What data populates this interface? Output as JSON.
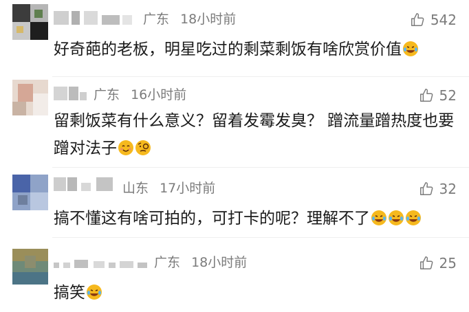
{
  "comments": [
    {
      "location": "广东",
      "time": "18小时前",
      "likes": "542",
      "text": "好奇葩的老板，明星吃过的剩菜剩饭有啥欣赏价值",
      "emojis": [
        "laughing-crying"
      ]
    },
    {
      "location": "广东",
      "time": "16小时前",
      "likes": "52",
      "text": "留剩饭菜有什么意义？留着发霉发臭？ 蹭流量蹭热度也要蹭对法子",
      "emojis": [
        "smiling",
        "puzzled-monocle"
      ]
    },
    {
      "location": "山东",
      "time": "17小时前",
      "likes": "32",
      "text": "搞不懂这有啥可拍的，可打卡的呢？理解不了",
      "emojis": [
        "laughing-crying",
        "laughing-crying",
        "laughing-crying"
      ]
    },
    {
      "location": "广东",
      "time": "18小时前",
      "likes": "25",
      "text": "搞笑",
      "emojis": [
        "laughing-crying"
      ]
    }
  ],
  "colors": {
    "meta": "#7b7b7b",
    "text": "#1a1a1a",
    "emoji": "#f6b91e"
  },
  "icons": {
    "like": "thumbs-up-outline-icon"
  }
}
